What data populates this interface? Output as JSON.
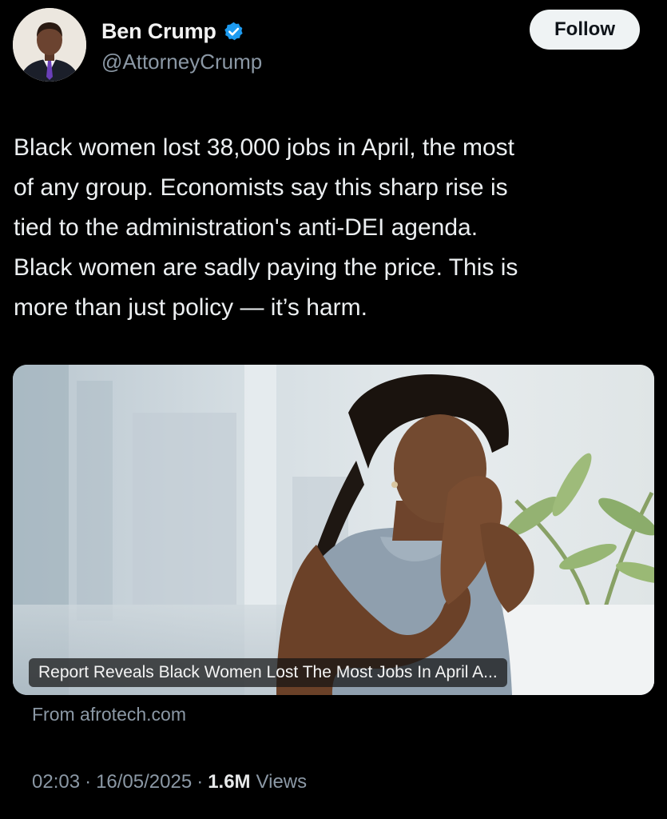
{
  "author": {
    "display_name": "Ben Crump",
    "handle": "@AttorneyCrump",
    "verified": true,
    "verified_color": "#1d9bf0"
  },
  "follow_button": {
    "label": "Follow"
  },
  "tweet": {
    "text_lines": [
      "Black women lost 38,000 jobs in April, the most",
      "of any group. Economists say this sharp rise is",
      "tied to the administration's anti-DEI agenda.",
      "Black women are sadly paying the price. This is",
      "more than just policy — it’s harm."
    ]
  },
  "card": {
    "headline": "Report Reveals Black Women Lost The Most Jobs In April A...",
    "source": "From afrotech.com"
  },
  "meta": {
    "time": "02:03",
    "separator": "·",
    "date": "16/05/2025",
    "views_count": "1.6M",
    "views_label": "Views"
  },
  "colors": {
    "background": "#000000",
    "text_primary": "#e7e9ea",
    "text_secondary": "#8b98a5",
    "follow_bg": "#eff3f4"
  }
}
